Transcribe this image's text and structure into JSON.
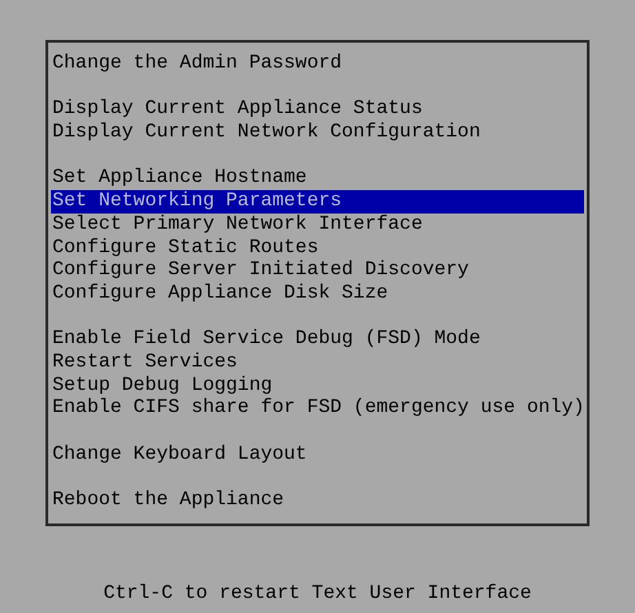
{
  "menu": {
    "groups": [
      {
        "items": [
          {
            "label": "Change the Admin Password",
            "selected": false
          }
        ]
      },
      {
        "items": [
          {
            "label": "Display Current Appliance Status",
            "selected": false
          },
          {
            "label": "Display Current Network Configuration",
            "selected": false
          }
        ]
      },
      {
        "items": [
          {
            "label": "Set Appliance Hostname",
            "selected": false
          },
          {
            "label": "Set Networking Parameters",
            "selected": true
          },
          {
            "label": "Select Primary Network Interface",
            "selected": false
          },
          {
            "label": "Configure Static Routes",
            "selected": false
          },
          {
            "label": "Configure Server Initiated Discovery",
            "selected": false
          },
          {
            "label": "Configure Appliance Disk Size",
            "selected": false
          }
        ]
      },
      {
        "items": [
          {
            "label": "Enable Field Service Debug (FSD) Mode",
            "selected": false
          },
          {
            "label": "Restart Services",
            "selected": false
          },
          {
            "label": "Setup Debug Logging",
            "selected": false
          },
          {
            "label": "Enable CIFS share for FSD (emergency use only)",
            "selected": false
          }
        ]
      },
      {
        "items": [
          {
            "label": "Change Keyboard Layout",
            "selected": false
          }
        ]
      },
      {
        "items": [
          {
            "label": "Reboot the Appliance",
            "selected": false
          }
        ]
      }
    ]
  },
  "footer": "Ctrl-C to restart Text User Interface"
}
